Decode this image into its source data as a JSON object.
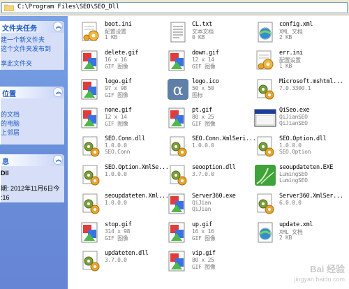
{
  "address": {
    "path": "C:\\Program Files\\SEO\\SEO_Dll",
    "icon": "folder-icon"
  },
  "taskpane": {
    "file_tasks": {
      "title": "文件夹任务",
      "links": [
        "建一个新文件夹",
        "这个文件夹发布到",
        "享此文件夹"
      ]
    },
    "other_places": {
      "title": "位置",
      "links": [
        "",
        "的文档",
        "的电脑",
        "上邻居"
      ]
    },
    "details": {
      "title": "息",
      "name": "Dll",
      "modified_line1": "期: 2012年11月6日今",
      "modified_line2": ":16"
    }
  },
  "files": [
    {
      "name": "boot.ini",
      "l2": "配置设置",
      "l3": "1 KB",
      "icon": "config-settings-icon",
      "col": 0,
      "row": 0
    },
    {
      "name": "CL.txt",
      "l2": "文本文档",
      "l3": "0 KB",
      "icon": "text-document-icon",
      "col": 1,
      "row": 0
    },
    {
      "name": "config.xml",
      "l2": "XML 文档",
      "l3": "2 KB",
      "icon": "xml-document-icon",
      "col": 2,
      "row": 0
    },
    {
      "name": "delete.gif",
      "l2": "16 x 16",
      "l3": "GIF 图像",
      "icon": "gif-image-icon",
      "col": 0,
      "row": 1
    },
    {
      "name": "down.gif",
      "l2": "12 x 14",
      "l3": "GIF 图像",
      "icon": "gif-image-icon",
      "col": 1,
      "row": 1
    },
    {
      "name": "err.ini",
      "l2": "配置设置",
      "l3": "1 KB",
      "icon": "config-settings-icon",
      "col": 2,
      "row": 1
    },
    {
      "name": "logo.gif",
      "l2": "97 x 98",
      "l3": "GIF 图像",
      "icon": "gif-image-icon",
      "col": 0,
      "row": 2
    },
    {
      "name": "logo.ico",
      "l2": "50 x 50",
      "l3": "图标",
      "icon": "ico-file-icon",
      "col": 1,
      "row": 2
    },
    {
      "name": "Microsoft.mshtml...",
      "l2": "7.0.3300.1",
      "l3": "",
      "icon": "dll-library-icon",
      "col": 2,
      "row": 2
    },
    {
      "name": "none.gif",
      "l2": "12 x 14",
      "l3": "GIF 图像",
      "icon": "gif-image-icon",
      "col": 0,
      "row": 3
    },
    {
      "name": "pt.gif",
      "l2": "80 x 25",
      "l3": "GIF 图像",
      "icon": "gif-image-icon",
      "col": 1,
      "row": 3
    },
    {
      "name": "QiSeo.exe",
      "l2": "QiJianSEO",
      "l3": "QiJianSEO",
      "icon": "exe-window-icon",
      "col": 2,
      "row": 3
    },
    {
      "name": "SEO.Conn.dll",
      "l2": "1.0.0.0",
      "l3": "SEO.Conn",
      "icon": "dll-library-icon",
      "col": 0,
      "row": 4
    },
    {
      "name": "SEO.Conn.XmlSeri...",
      "l2": "1.0.0.0",
      "l3": "",
      "icon": "dll-library-icon",
      "col": 1,
      "row": 4
    },
    {
      "name": "SEO.Option.dll",
      "l2": "1.0.0.0",
      "l3": "SEO.Option",
      "icon": "dll-library-icon",
      "col": 2,
      "row": 4
    },
    {
      "name": "SEO.Option.XmlSe...",
      "l2": "1.0.0.0",
      "l3": "",
      "icon": "dll-library-icon",
      "col": 0,
      "row": 5
    },
    {
      "name": "seooption.dll",
      "l2": "3.7.0.0",
      "l3": "",
      "icon": "dll-library-icon",
      "col": 1,
      "row": 5
    },
    {
      "name": "seoupdateten.EXE",
      "l2": "LumingSEO",
      "l3": "LumingSEO",
      "icon": "exe-app-icon",
      "col": 2,
      "row": 5
    },
    {
      "name": "seoupdateten.Xml...",
      "l2": "1.0.0.0",
      "l3": "",
      "icon": "dll-library-icon",
      "col": 0,
      "row": 6
    },
    {
      "name": "Server360.exe",
      "l2": "QiJian",
      "l3": "QiJian",
      "icon": "gif-image-icon",
      "col": 1,
      "row": 6
    },
    {
      "name": "Server360.XmlSer...",
      "l2": "6.0.0.0",
      "l3": "",
      "icon": "dll-library-icon",
      "col": 2,
      "row": 6
    },
    {
      "name": "stop.gif",
      "l2": "314 x 98",
      "l3": "GIF 图像",
      "icon": "gif-image-icon",
      "col": 0,
      "row": 7
    },
    {
      "name": "up.gif",
      "l2": "16 x 16",
      "l3": "GIF 图像",
      "icon": "gif-image-icon",
      "col": 1,
      "row": 7
    },
    {
      "name": "update.xml",
      "l2": "XML 文档",
      "l3": "2 KB",
      "icon": "xml-document-icon",
      "col": 2,
      "row": 7
    },
    {
      "name": "updateten.dll",
      "l2": "3.7.0.0",
      "l3": "",
      "icon": "dll-library-icon",
      "col": 0,
      "row": 8
    },
    {
      "name": "vip.gif",
      "l2": "80 x 25",
      "l3": "GIF 图像",
      "icon": "gif-image-icon",
      "col": 1,
      "row": 8
    }
  ],
  "watermark": {
    "brand": "Bai 经验",
    "url": "jingyan.baidu.com"
  },
  "colors": {
    "taskpane": "#6a8fd9",
    "link": "#215dc6",
    "detail": "#7d7d7d"
  }
}
